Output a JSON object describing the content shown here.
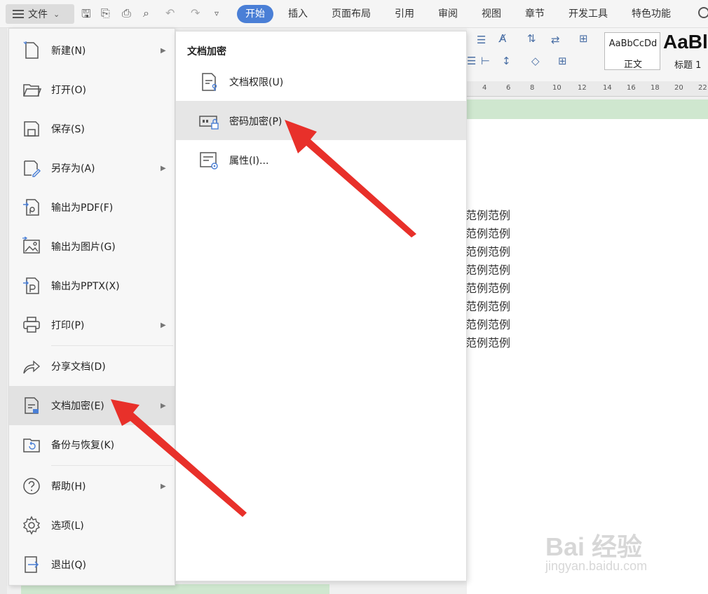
{
  "toolbar": {
    "file_label": "文件",
    "tabs": [
      "开始",
      "插入",
      "页面布局",
      "引用",
      "审阅",
      "视图",
      "章节",
      "开发工具",
      "特色功能"
    ]
  },
  "ribbon": {
    "style_normal_preview": "AaBbCcDd",
    "style_normal_name": "正文",
    "style_heading_preview": "AaBl",
    "style_heading_name": "标题 1"
  },
  "ruler": [
    "4",
    "6",
    "8",
    "10",
    "12",
    "14",
    "16",
    "18",
    "20",
    "22"
  ],
  "document": {
    "lines": [
      "范例范例",
      "范例范例",
      "范例范例",
      "范例范例",
      "范例范例",
      "范例范例",
      "范例范例",
      "范例范例"
    ]
  },
  "file_menu": {
    "items": [
      {
        "label": "新建(N)",
        "icon": "new-doc-icon",
        "submenu": true
      },
      {
        "label": "打开(O)",
        "icon": "folder-open-icon",
        "submenu": false
      },
      {
        "label": "保存(S)",
        "icon": "save-icon",
        "submenu": false
      },
      {
        "label": "另存为(A)",
        "icon": "save-as-icon",
        "submenu": true
      },
      {
        "label": "输出为PDF(F)",
        "icon": "export-pdf-icon",
        "submenu": false
      },
      {
        "label": "输出为图片(G)",
        "icon": "export-image-icon",
        "submenu": false
      },
      {
        "label": "输出为PPTX(X)",
        "icon": "export-pptx-icon",
        "submenu": false
      },
      {
        "label": "打印(P)",
        "icon": "print-icon",
        "submenu": true
      },
      {
        "label": "分享文档(D)",
        "icon": "share-icon",
        "submenu": false
      },
      {
        "label": "文档加密(E)",
        "icon": "doc-encrypt-icon",
        "submenu": true,
        "highlighted": true
      },
      {
        "label": "备份与恢复(K)",
        "icon": "backup-restore-icon",
        "submenu": false
      },
      {
        "label": "帮助(H)",
        "icon": "help-icon",
        "submenu": true
      },
      {
        "label": "选项(L)",
        "icon": "gear-icon",
        "submenu": false
      },
      {
        "label": "退出(Q)",
        "icon": "exit-icon",
        "submenu": false
      }
    ]
  },
  "submenu": {
    "title": "文档加密",
    "items": [
      {
        "label": "文档权限(U)",
        "icon": "doc-permission-icon"
      },
      {
        "label": "密码加密(P)",
        "icon": "password-encrypt-icon",
        "highlighted": true
      },
      {
        "label": "属性(I)...",
        "icon": "properties-icon"
      }
    ]
  },
  "watermark": {
    "brand": "Bai 经验",
    "url": "jingyan.baidu.com"
  },
  "colors": {
    "accent": "#4a7fd6",
    "arrow": "#e8302a",
    "doc_band": "#cfe7cf"
  }
}
